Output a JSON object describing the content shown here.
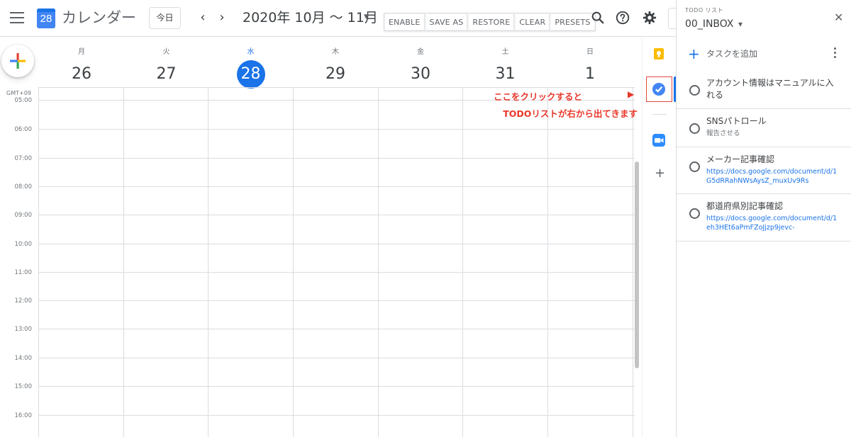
{
  "header": {
    "app_title": "カレンダー",
    "logo_day": "28",
    "today_label": "今日",
    "prev_arrow": "‹",
    "next_arrow": "›",
    "date_range": "2020年 10月 〜 11月",
    "date_dropdown": "▼"
  },
  "extension_toolbar": {
    "buttons": [
      "ENABLE",
      "SAVE AS",
      "RESTORE",
      "CLEAR",
      "PRESETS"
    ]
  },
  "week": {
    "days": [
      {
        "name": "月",
        "date": "26",
        "today": false
      },
      {
        "name": "火",
        "date": "27",
        "today": false
      },
      {
        "name": "水",
        "date": "28",
        "today": true
      },
      {
        "name": "木",
        "date": "29",
        "today": false
      },
      {
        "name": "金",
        "date": "30",
        "today": false
      },
      {
        "name": "土",
        "date": "31",
        "today": false
      },
      {
        "name": "日",
        "date": "1",
        "today": false
      }
    ],
    "timezone": "GMT+09",
    "hours": [
      "05:00",
      "06:00",
      "07:00",
      "08:00",
      "09:00",
      "10:00",
      "11:00",
      "12:00",
      "13:00",
      "14:00",
      "15:00",
      "16:00"
    ]
  },
  "annotation": {
    "line1": "ここをクリックすると",
    "line2": "TODOリストが右から出てきます",
    "arrow": "▶"
  },
  "sidebar_icons": [
    "keep-icon",
    "tasks-icon",
    "zoom-icon",
    "add-icon"
  ],
  "colors": {
    "accent": "#1a73e8",
    "annotation": "#e8382a"
  },
  "todo": {
    "small_label": "TODO リスト",
    "list_name": "00_INBOX",
    "list_dropdown": "▾",
    "close": "✕",
    "add_task": "タスクを追加",
    "add_plus": "+",
    "tasks": [
      {
        "title": "アカウント情報はマニュアルに入れる",
        "sub": "",
        "link": ""
      },
      {
        "title": "SNSパトロール",
        "sub": "報告させる",
        "link": ""
      },
      {
        "title": "メーカー記事確認",
        "sub": "",
        "link": "https://docs.google.com/document/d/1G5dRRahNWsAysZ_muxUv9Rs"
      },
      {
        "title": "都道府県別記事確認",
        "sub": "",
        "link": "https://docs.google.com/document/d/1eh3HEt6aPmFZoJjzp9jevc-"
      }
    ]
  }
}
